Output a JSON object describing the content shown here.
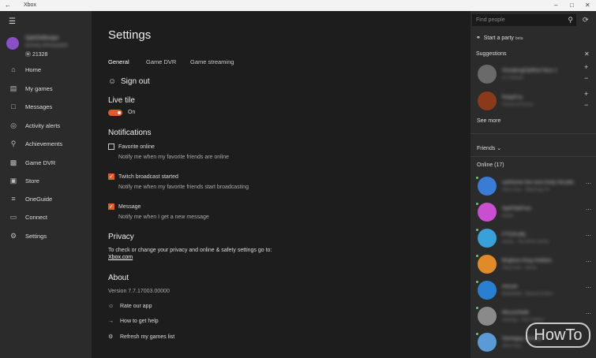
{
  "window": {
    "title": "Xbox"
  },
  "sidebar": {
    "score": "21328",
    "gamertag": "SplitSeBeepe",
    "subname": "Beverly Whiskeyden",
    "items": [
      {
        "label": "Home",
        "icon": "home-icon"
      },
      {
        "label": "My games",
        "icon": "games-icon"
      },
      {
        "label": "Messages",
        "icon": "messages-icon"
      },
      {
        "label": "Activity alerts",
        "icon": "globe-icon"
      },
      {
        "label": "Achievements",
        "icon": "trophy-icon"
      },
      {
        "label": "Game DVR",
        "icon": "dvr-icon"
      },
      {
        "label": "Store",
        "icon": "store-icon"
      },
      {
        "label": "OneGuide",
        "icon": "oneguide-icon"
      },
      {
        "label": "Connect",
        "icon": "connect-icon"
      },
      {
        "label": "Settings",
        "icon": "gear-icon"
      }
    ]
  },
  "main": {
    "title": "Settings",
    "tabs": [
      "General",
      "Game DVR",
      "Game streaming"
    ],
    "sign_out": "Sign out",
    "live_tile": {
      "heading": "Live tile",
      "state": "On"
    },
    "notifications": {
      "heading": "Notifications",
      "items": [
        {
          "label": "Favorite online",
          "desc": "Notify me when my favorite friends are online",
          "checked": false
        },
        {
          "label": "Twitch broadcast started",
          "desc": "Notify me when my favorite friends start broadcasting",
          "checked": true
        },
        {
          "label": "Message",
          "desc": "Notify me when I get a new message",
          "checked": true
        }
      ]
    },
    "privacy": {
      "heading": "Privacy",
      "text": "To check or change your privacy and online & safety settings go to:",
      "link": "Xbox.com"
    },
    "about": {
      "heading": "About",
      "version": "Version 7.7.17003.00000",
      "items": [
        {
          "label": "Rate our app",
          "icon": "smiley-icon"
        },
        {
          "label": "How to get help",
          "icon": "arrow-right-icon"
        },
        {
          "label": "Refresh my games list",
          "icon": "controller-icon"
        }
      ]
    }
  },
  "right_panel": {
    "search_placeholder": "Find people",
    "party": "Start a party",
    "party_beta": "beta",
    "suggestions_title": "Suggestions",
    "suggestions": [
      {
        "name": "SneakingOddNut Nice 1",
        "sub": "In 2 friends",
        "color": "#6a6a6a"
      },
      {
        "name": "RubyFox",
        "sub": "Friend of Friend",
        "color": "#8a3a1a"
      }
    ],
    "see_more": "See more",
    "friends_label": "Friends",
    "online_label": "Online (17)",
    "friends": [
      {
        "name": "carthome the nest  Andy Noodle",
        "sub": "Xbox One - Watching TV",
        "color": "#3a7bd5"
      },
      {
        "name": "SplitTalkFest",
        "sub": "Home",
        "color": "#c94fd0"
      },
      {
        "name": "FTCDruffy",
        "sub": "Home - The Brick Series",
        "color": "#3aa0d8"
      },
      {
        "name": "Brighton  King Hobbes",
        "sub": "Xbox One - Home",
        "color": "#e08a2a"
      },
      {
        "name": "inmuel",
        "sub": "Battlefield - Shared Online",
        "color": "#2a80d0"
      },
      {
        "name": "MouseStalk",
        "sub": "Gaming - Tech Online",
        "color": "#8a8a8a"
      },
      {
        "name": "Sameguy  Jerome",
        "sub": "Xbox One",
        "color": "#5a9ad5"
      }
    ]
  },
  "watermark": "HowTo"
}
